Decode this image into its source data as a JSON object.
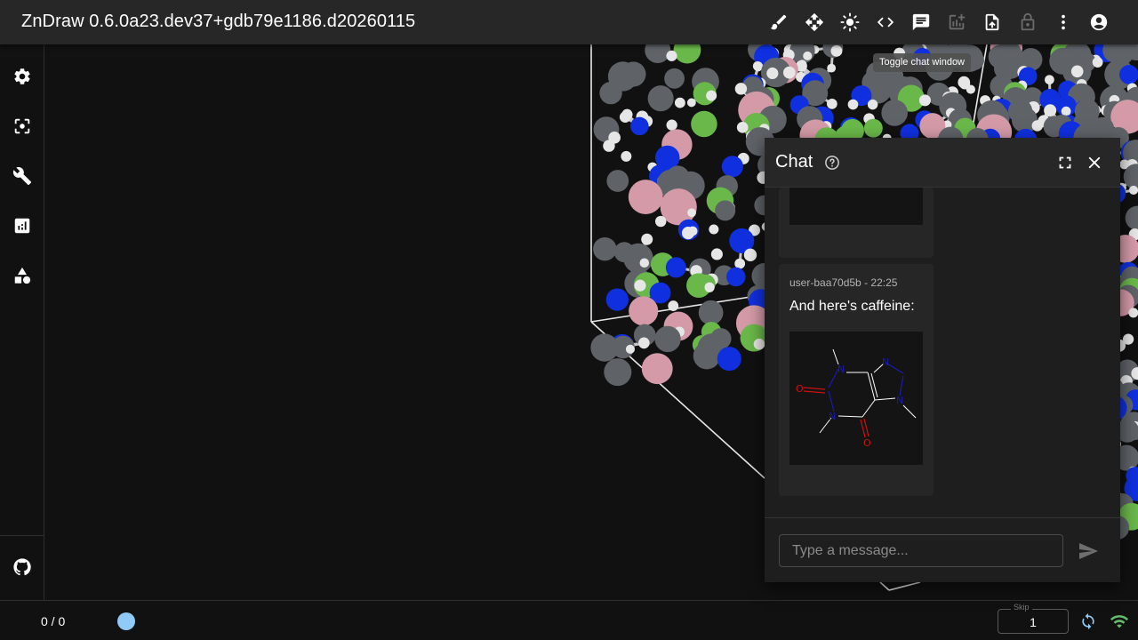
{
  "app": {
    "title": "ZnDraw 0.6.0a23.dev37+gdb79e1186.d20260115"
  },
  "toolbar": {
    "icons": [
      "brush-icon",
      "move-icon",
      "brightness-icon",
      "code-icon",
      "chat-icon",
      "add-chart-icon",
      "upload-file-icon",
      "lock-icon",
      "more-vert-icon",
      "account-icon"
    ],
    "tooltip": "Toggle chat window"
  },
  "sidebar": {
    "icons": [
      "settings-icon",
      "center-focus-icon",
      "build-icon",
      "analytics-icon",
      "geometry-icon",
      "github-icon"
    ]
  },
  "chat": {
    "title": "Chat",
    "messages": [
      {
        "author_time": "user-baa70d5b - 22:25",
        "text": "And here's caffeine:"
      }
    ],
    "input_placeholder": "Type a message..."
  },
  "bottom": {
    "frame_counter": "0 / 0",
    "skip_label": "Skip",
    "skip_value": "1"
  },
  "colors": {
    "topbar": "#272727",
    "background": "#111111",
    "accent_blue": "#90caf9",
    "wifi_green": "#66bb6a",
    "carbon": "#5f6368",
    "hydrogen": "#e6e6e6",
    "nitrogen": "#1030e0",
    "fluorine": "#6ab84a",
    "pink_atom": "#d49aa8"
  }
}
